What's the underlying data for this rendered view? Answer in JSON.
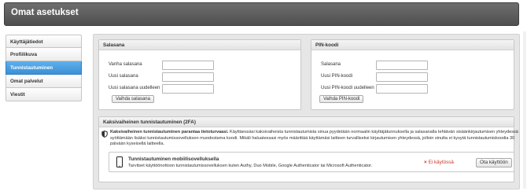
{
  "header": {
    "title": "Omat asetukset"
  },
  "sidebar": {
    "items": [
      {
        "label": "Käyttäjätiedot",
        "active": false
      },
      {
        "label": "Profiilikuva",
        "active": false
      },
      {
        "label": "Tunnistautuminen",
        "active": true
      },
      {
        "label": "Omat palvelut",
        "active": false
      },
      {
        "label": "Viestit",
        "active": false
      }
    ]
  },
  "password_panel": {
    "title": "Salasana",
    "fields": [
      {
        "label": "Vanha salasana",
        "value": ""
      },
      {
        "label": "Uusi salasana",
        "value": ""
      },
      {
        "label": "Uusi salasana uudelleen",
        "value": ""
      }
    ],
    "button": "Vaihda salasana"
  },
  "pin_panel": {
    "title": "PIN-koodi",
    "fields": [
      {
        "label": "Salasana",
        "value": ""
      },
      {
        "label": "Uusi PIN-koodi",
        "value": ""
      },
      {
        "label": "Uusi PIN-koodi uudelleen",
        "value": ""
      }
    ],
    "button": "Vaihda PIN-koodi"
  },
  "tfa_panel": {
    "title": "Kaksivaiheinen tunnistautuminen (2FA)",
    "intro_bold": "Kaksivaiheinen tunnistautuminen parantaa tietoturvaasi.",
    "intro_text": " Käyttäessäsi kaksivaiheista tunnistautumista sinua pyydetään normaalin käyttäjätunnuksella ja salasanalla tehtävän sisäänkirjautumisen yhteydessä syöttämään lisäksi tunnistautumissovelluksen muodostama koodi. Mikäli haluatessasi myös määrittää käyttämäsi laitteen turvalliseksi kirjautumisen yhteydessä, jolloin sinulta ei kysytä tunnistautumiskoodia 30 päivään kyseisellä laitteella.",
    "app": {
      "title": "Tunnistautuminen mobiilisovelluksella",
      "description": "Tarvitset käyttöönottoon tunnistautumissovelluksen kuten Authy, Duo Mobile, Google Authenticator tai Microsoft Authenticator.",
      "status_icon": "×",
      "status": "Ei käytössä",
      "button": "Ota käyttöön"
    }
  },
  "colors": {
    "accent": "#3b8fd5",
    "header": "#5a5a5a",
    "status_off": "#c0392b"
  }
}
